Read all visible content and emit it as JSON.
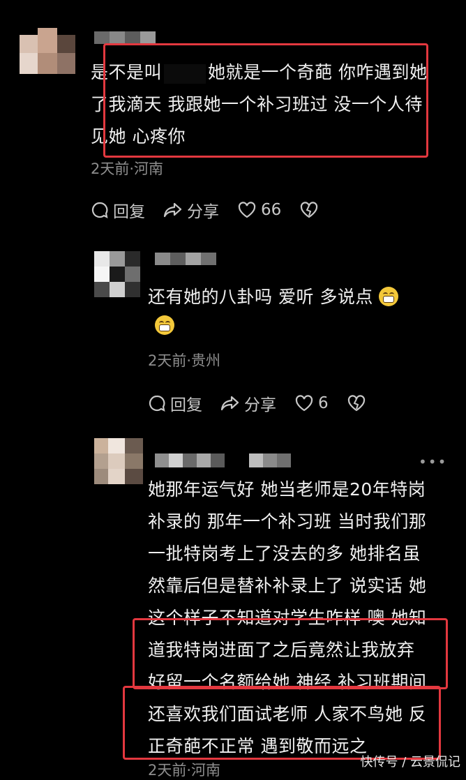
{
  "comments": [
    {
      "text_lines": [
        "是不是叫",
        "她就是一个奇葩 你咋遇到她",
        "了我滴天 我跟她一个补习班过 没一个人待",
        "见她 心疼你"
      ],
      "meta": "2天前·河南",
      "reply_label": "回复",
      "share_label": "分享",
      "likes": "66"
    },
    {
      "text_lines": [
        "还有她的八卦吗 爱听  多说点"
      ],
      "meta": "2天前·贵州",
      "reply_label": "回复",
      "share_label": "分享",
      "likes": "6"
    },
    {
      "text_lines": [
        "她那年运气好 她当老师是20年特岗",
        "补录的 那年一个补习班 当时我们那",
        "一批特岗考上了没去的多 她排名虽",
        "然靠后但是替补补录上了 说实话 她",
        "这个样子不知道对学生咋样 噢 她知",
        "道我特岗进面了之后竟然让我放弃",
        "好留一个名额给她 神经 补习班期间",
        "还喜欢我们面试老师 人家不鸟她 反",
        "正奇葩不正常  遇到敬而远之"
      ],
      "meta": "2天前·河南"
    }
  ],
  "watermark": "快传号 / 云景侃记",
  "colors": {
    "highlight": "#e3383f",
    "meta": "#8e8e8e",
    "background": "#000000"
  }
}
